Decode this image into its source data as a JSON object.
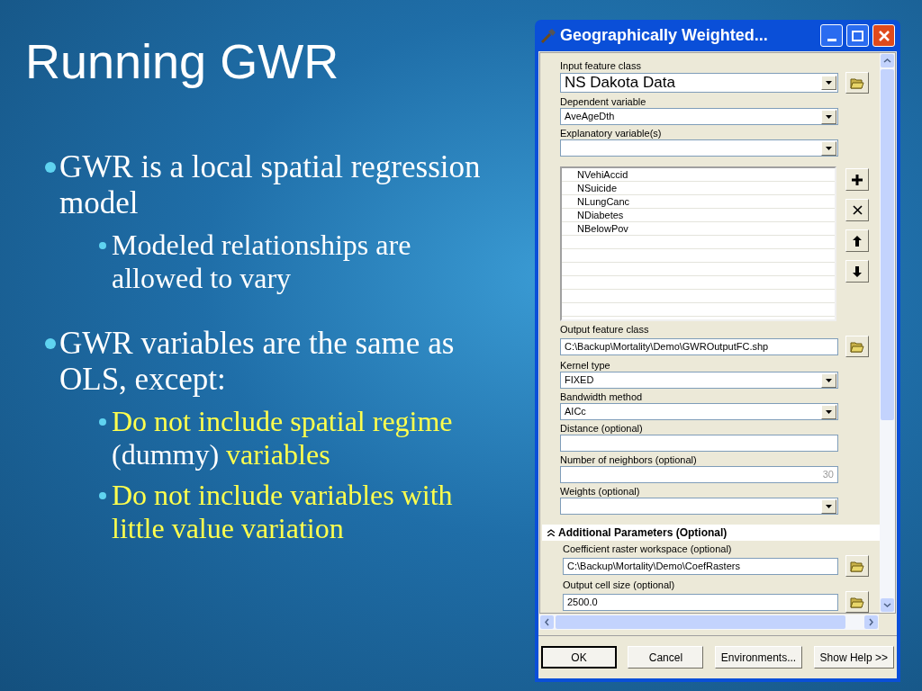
{
  "slide": {
    "title": "Running GWR",
    "bullets": [
      {
        "segments": [
          {
            "text": "GWR is a local spatial regression model",
            "highlighted": false
          }
        ],
        "children": [
          {
            "segments": [
              {
                "text": "Modeled relationships are allowed to vary",
                "highlighted": false
              }
            ]
          }
        ]
      },
      {
        "segments": [
          {
            "text": "GWR variables are the same as OLS, except:",
            "highlighted": false
          }
        ],
        "children": [
          {
            "segments": [
              {
                "text": "Do not include spatial regime",
                "highlighted": true
              },
              {
                "text": "(dummy)",
                "highlighted": false
              },
              {
                "text": "variables",
                "highlighted": true
              }
            ]
          },
          {
            "segments": [
              {
                "text": "Do not include variables with little value variation",
                "highlighted": true
              }
            ]
          }
        ]
      }
    ]
  },
  "dialog": {
    "title": "Geographically Weighted...",
    "fields": [
      {
        "kind": "dropdown",
        "label": "Input feature class",
        "value": "NS Dakota Data",
        "emphasis": true,
        "browse": true
      },
      {
        "kind": "dropdown",
        "label": "Dependent variable",
        "value": "AveAgeDth"
      },
      {
        "kind": "dropdown",
        "label": "Explanatory variable(s)"
      },
      {
        "kind": "list",
        "items": [
          "NVehiAccid",
          "NSuicide",
          "NLungCanc",
          "NDiabetes",
          "NBelowPov"
        ]
      },
      {
        "kind": "text",
        "label": "Output feature class",
        "value": "C:\\Backup\\Mortality\\Demo\\GWROutputFC.shp",
        "browse": true
      },
      {
        "kind": "dropdown",
        "label": "Kernel type",
        "value": "FIXED"
      },
      {
        "kind": "dropdown",
        "label": "Bandwidth method",
        "value": "AICc"
      },
      {
        "kind": "text",
        "label": "Distance (optional)"
      },
      {
        "kind": "text",
        "label": "Number of neighbors (optional)",
        "value": "30",
        "disabled": true
      },
      {
        "kind": "dropdown",
        "label": "Weights (optional)"
      }
    ],
    "section": {
      "title": "Additional Parameters (Optional)",
      "expanded": true,
      "fields": [
        {
          "kind": "text",
          "label": "Coefficient raster workspace (optional)",
          "value": "C:\\Backup\\Mortality\\Demo\\CoefRasters",
          "browse": true
        },
        {
          "kind": "text",
          "label": "Output cell size (optional)",
          "value": "2500.0",
          "browse": true
        }
      ]
    },
    "buttons": [
      {
        "label": "OK",
        "default": true
      },
      {
        "label": "Cancel",
        "default": false
      },
      {
        "label": "Environments...",
        "default": false
      },
      {
        "label": "Show Help >>",
        "default": false
      }
    ]
  }
}
